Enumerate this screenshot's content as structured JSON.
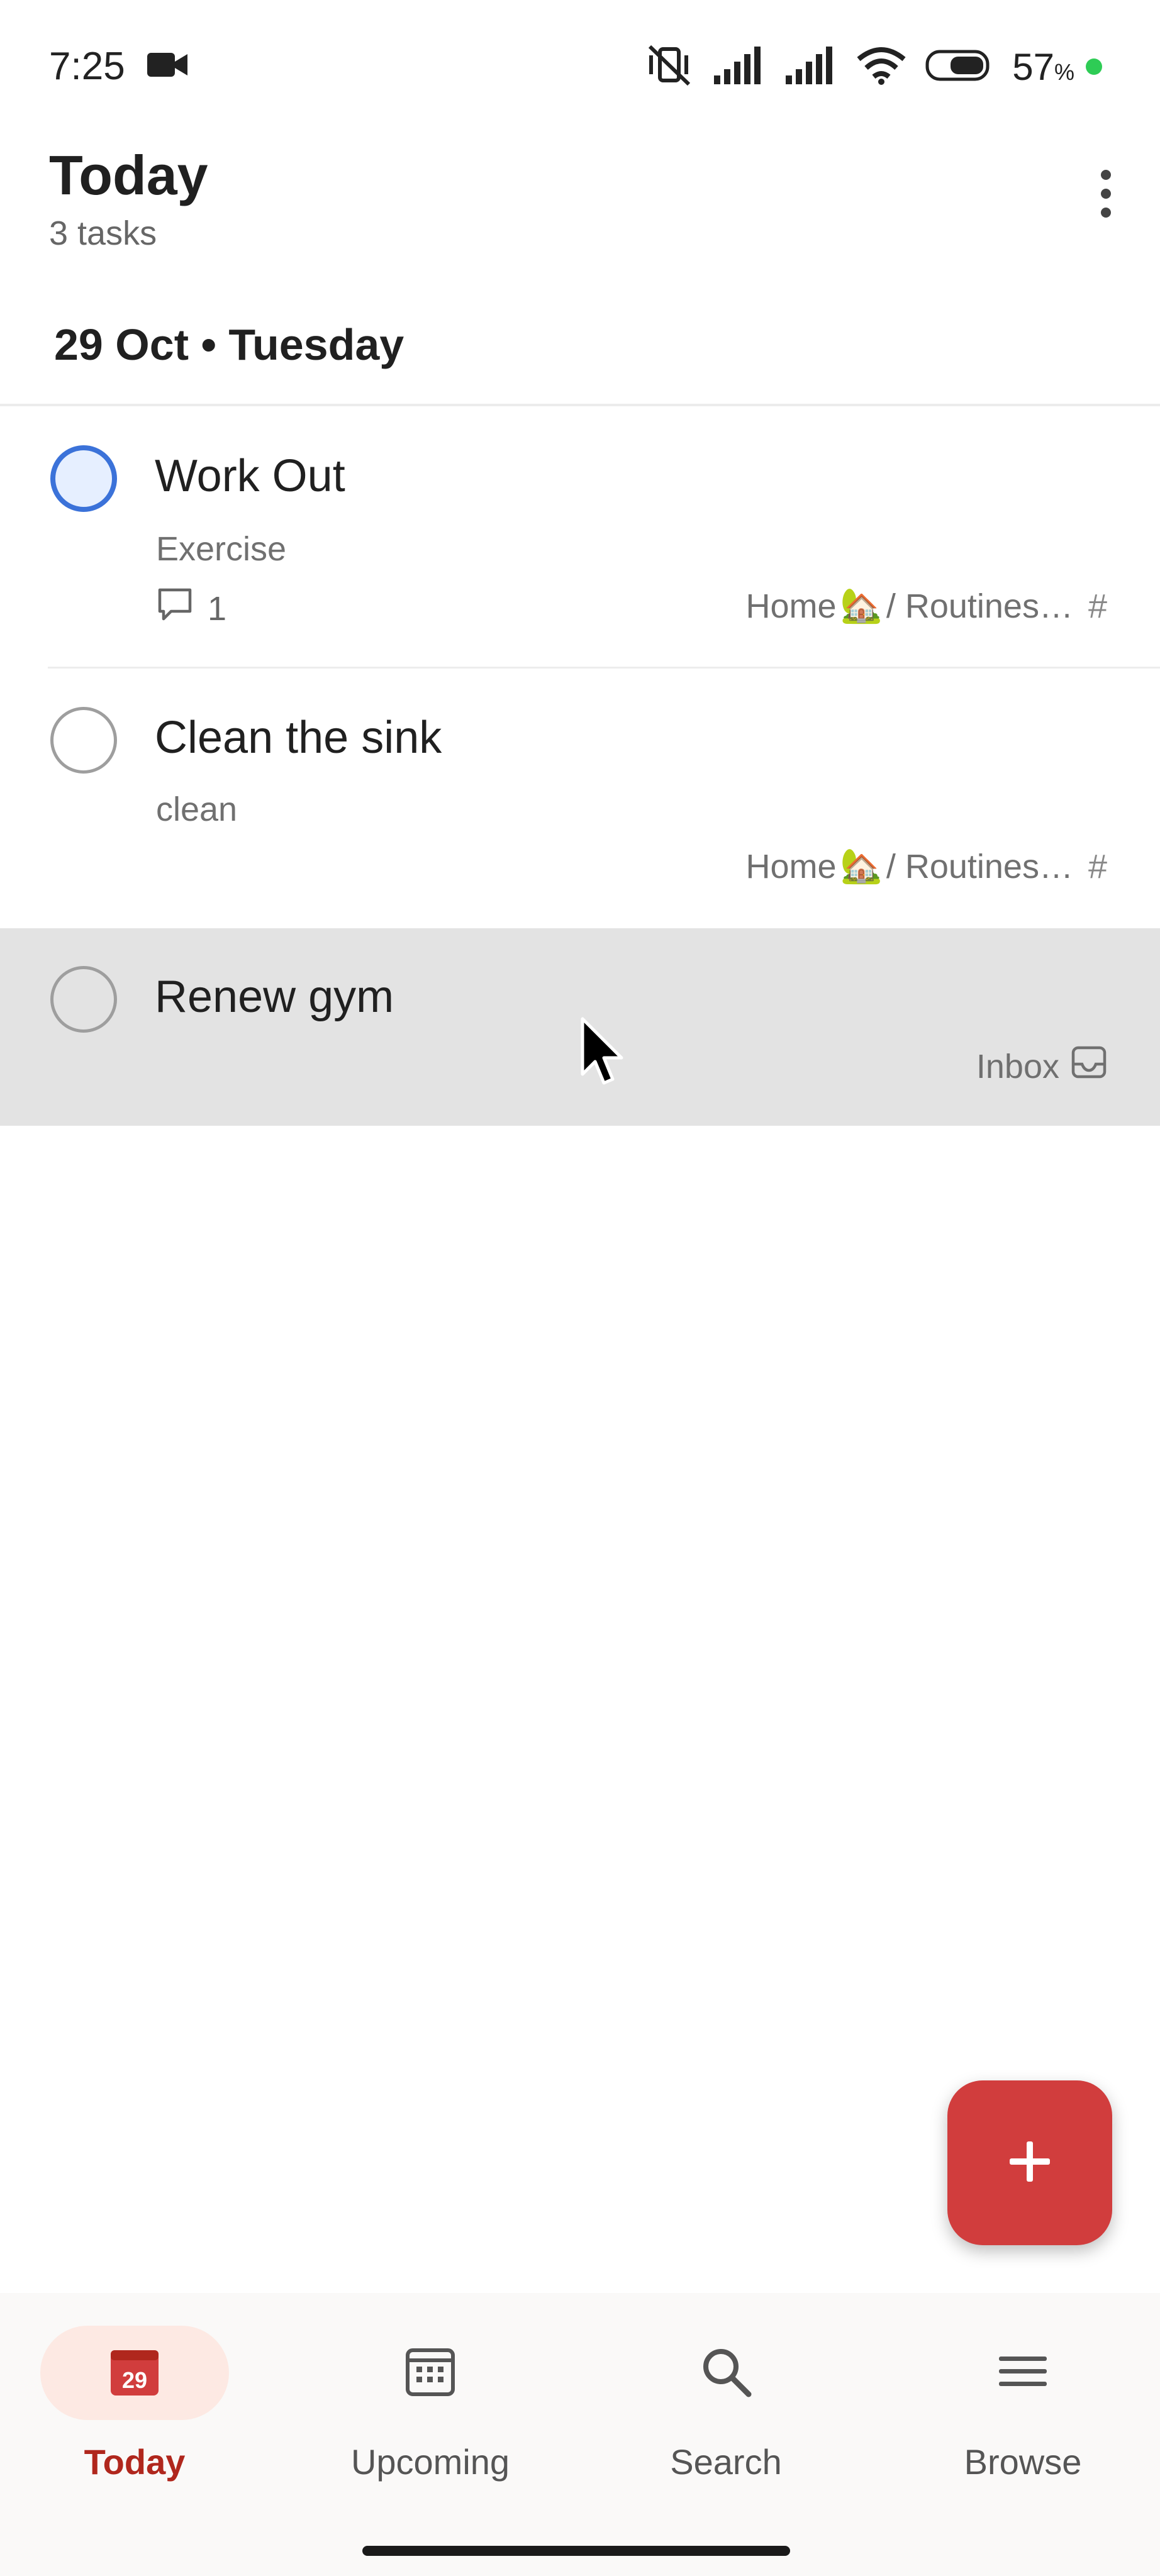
{
  "status_bar": {
    "time": "7:25",
    "battery_percent": "57",
    "battery_unit": "%"
  },
  "header": {
    "title": "Today",
    "subtitle": "3 tasks"
  },
  "section": {
    "date_label": "29 Oct • Tuesday"
  },
  "tasks": [
    {
      "title": "Work Out",
      "description": "Exercise",
      "comment_count": "1",
      "project": "Home",
      "project_emoji": "🏡",
      "section": "/ Routines…",
      "project_icon": "#",
      "priority_color": "#3b72d9"
    },
    {
      "title": "Clean the sink",
      "description": "clean",
      "project": "Home",
      "project_emoji": "🏡",
      "section": "/ Routines…",
      "project_icon": "#"
    },
    {
      "title": "Renew gym",
      "project": "Inbox",
      "selected": true
    }
  ],
  "fab": {
    "icon": "plus-icon",
    "color": "#d13d3d"
  },
  "nav": {
    "items": [
      {
        "label": "Today",
        "icon": "calendar-today-icon",
        "badge": "29",
        "active": true
      },
      {
        "label": "Upcoming",
        "icon": "calendar-grid-icon"
      },
      {
        "label": "Search",
        "icon": "search-icon"
      },
      {
        "label": "Browse",
        "icon": "menu-icon"
      }
    ]
  },
  "colors": {
    "accent": "#b0271d",
    "fab": "#d13d3d",
    "active_nav_bg": "#fde9e3"
  }
}
